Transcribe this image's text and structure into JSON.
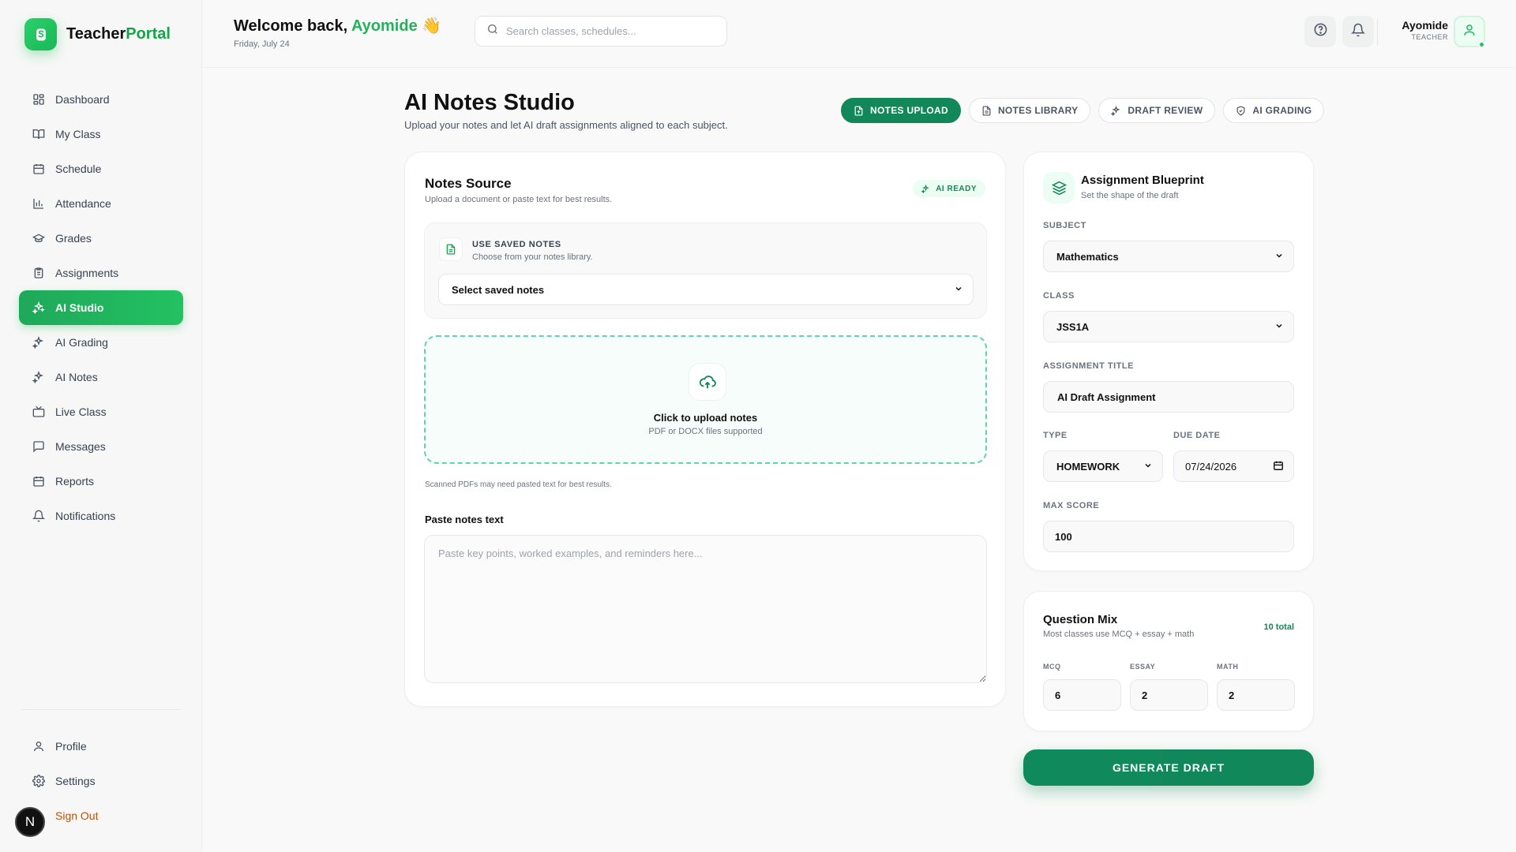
{
  "brand": {
    "name_part1": "Teacher",
    "name_part2": "Portal"
  },
  "header": {
    "welcome_prefix": "Welcome back, ",
    "user_first_name": "Ayomide",
    "wave": "👋",
    "date": "Friday, July 24",
    "search_placeholder": "Search classes, schedules...",
    "user_name": "Ayomide",
    "user_role": "TEACHER"
  },
  "sidebar": {
    "items": [
      {
        "label": "Dashboard",
        "icon": "dashboard-icon"
      },
      {
        "label": "My Class",
        "icon": "book-icon"
      },
      {
        "label": "Schedule",
        "icon": "calendar-icon"
      },
      {
        "label": "Attendance",
        "icon": "bar-chart-icon"
      },
      {
        "label": "Grades",
        "icon": "graduation-cap-icon"
      },
      {
        "label": "Assignments",
        "icon": "clipboard-icon"
      },
      {
        "label": "AI Studio",
        "icon": "sparkles-icon",
        "active": true
      },
      {
        "label": "AI Grading",
        "icon": "sparkles-icon"
      },
      {
        "label": "AI Notes",
        "icon": "sparkles-icon"
      },
      {
        "label": "Live Class",
        "icon": "tv-icon"
      },
      {
        "label": "Messages",
        "icon": "message-icon"
      },
      {
        "label": "Reports",
        "icon": "calendar-icon"
      },
      {
        "label": "Notifications",
        "icon": "bell-icon"
      }
    ],
    "bottom": [
      {
        "label": "Profile",
        "icon": "user-icon"
      },
      {
        "label": "Settings",
        "icon": "gear-icon"
      },
      {
        "label": "Sign Out",
        "icon": "logout-icon"
      }
    ],
    "avatar_letter": "N"
  },
  "page": {
    "title": "AI Notes Studio",
    "subtitle": "Upload your notes and let AI draft assignments aligned to each subject.",
    "tabs": [
      {
        "label": "NOTES UPLOAD",
        "active": true
      },
      {
        "label": "NOTES LIBRARY"
      },
      {
        "label": "DRAFT REVIEW"
      },
      {
        "label": "AI GRADING"
      }
    ]
  },
  "notes_source": {
    "title": "Notes Source",
    "subtitle": "Upload a document or paste text for best results.",
    "badge": "AI READY",
    "saved_title": "USE SAVED NOTES",
    "saved_subtitle": "Choose from your notes library.",
    "saved_select": "Select saved notes",
    "upload_title": "Click to upload notes",
    "upload_subtitle": "PDF or DOCX files supported",
    "hint": "Scanned PDFs may need pasted text for best results.",
    "paste_label": "Paste notes text",
    "paste_placeholder": "Paste key points, worked examples, and reminders here..."
  },
  "blueprint": {
    "title": "Assignment Blueprint",
    "subtitle": "Set the shape of the draft",
    "subject_label": "SUBJECT",
    "subject_value": "Mathematics",
    "class_label": "CLASS",
    "class_value": "JSS1A",
    "title_label": "ASSIGNMENT TITLE",
    "title_value": "AI Draft Assignment",
    "type_label": "TYPE",
    "type_value": "HOMEWORK",
    "due_label": "DUE DATE",
    "due_value": "07/24/2026",
    "max_label": "MAX SCORE",
    "max_value": "100"
  },
  "question_mix": {
    "title": "Question Mix",
    "subtitle": "Most classes use MCQ + essay + math",
    "total": "10 total",
    "mcq_label": "MCQ",
    "mcq_value": "6",
    "essay_label": "ESSAY",
    "essay_value": "2",
    "math_label": "MATH",
    "math_value": "2"
  },
  "generate_label": "GENERATE DRAFT",
  "colors": {
    "accent": "#12875a",
    "accent_bright": "#22c55e",
    "upload_border": "#5dd6aa"
  }
}
